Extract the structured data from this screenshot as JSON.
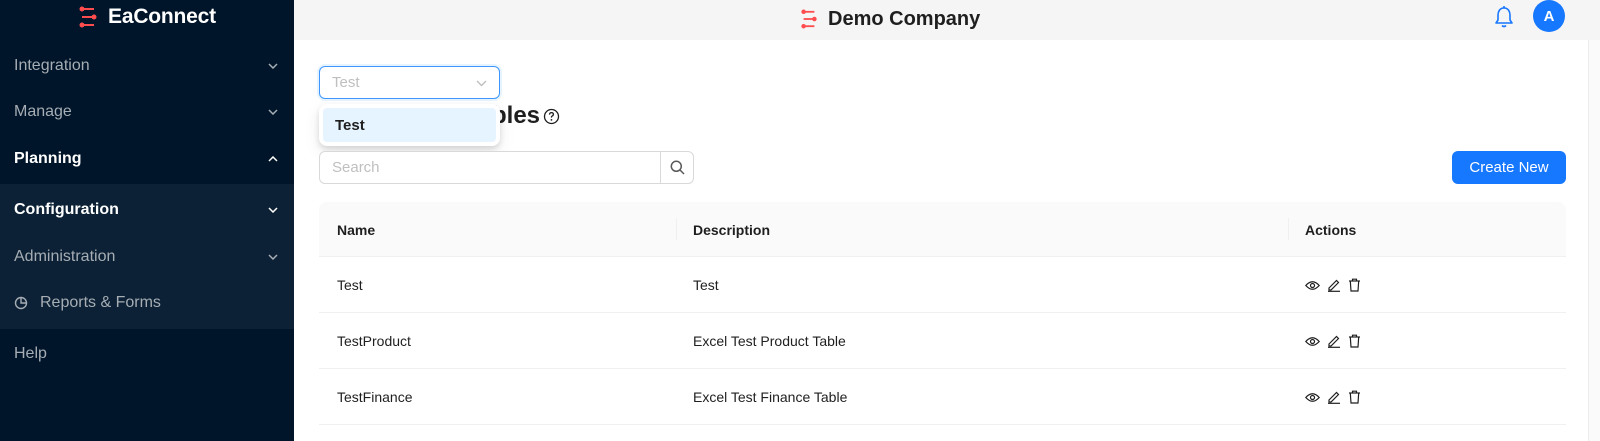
{
  "brand": {
    "name": "EaConnect",
    "accent": "#ff4d4f"
  },
  "sidebar": {
    "items": [
      {
        "label": "Integration"
      },
      {
        "label": "Manage"
      },
      {
        "label": "Planning"
      },
      {
        "label": "Configuration"
      },
      {
        "label": "Administration"
      },
      {
        "label": "Reports & Forms"
      },
      {
        "label": "Help"
      }
    ]
  },
  "header": {
    "company": "Demo Company",
    "avatar_initial": "A"
  },
  "selector": {
    "value": "Test",
    "options": [
      "Test"
    ]
  },
  "page": {
    "title_visible_fragment": "bles"
  },
  "search": {
    "placeholder": "Search"
  },
  "toolbar": {
    "create_label": "Create New"
  },
  "table": {
    "columns": [
      "Name",
      "Description",
      "Actions"
    ],
    "rows": [
      {
        "name": "Test",
        "description": "Test"
      },
      {
        "name": "TestProduct",
        "description": "Excel Test Product Table"
      },
      {
        "name": "TestFinance",
        "description": "Excel Test Finance Table"
      }
    ]
  },
  "colors": {
    "sidebar": "#001529",
    "primary": "#1677ff"
  }
}
